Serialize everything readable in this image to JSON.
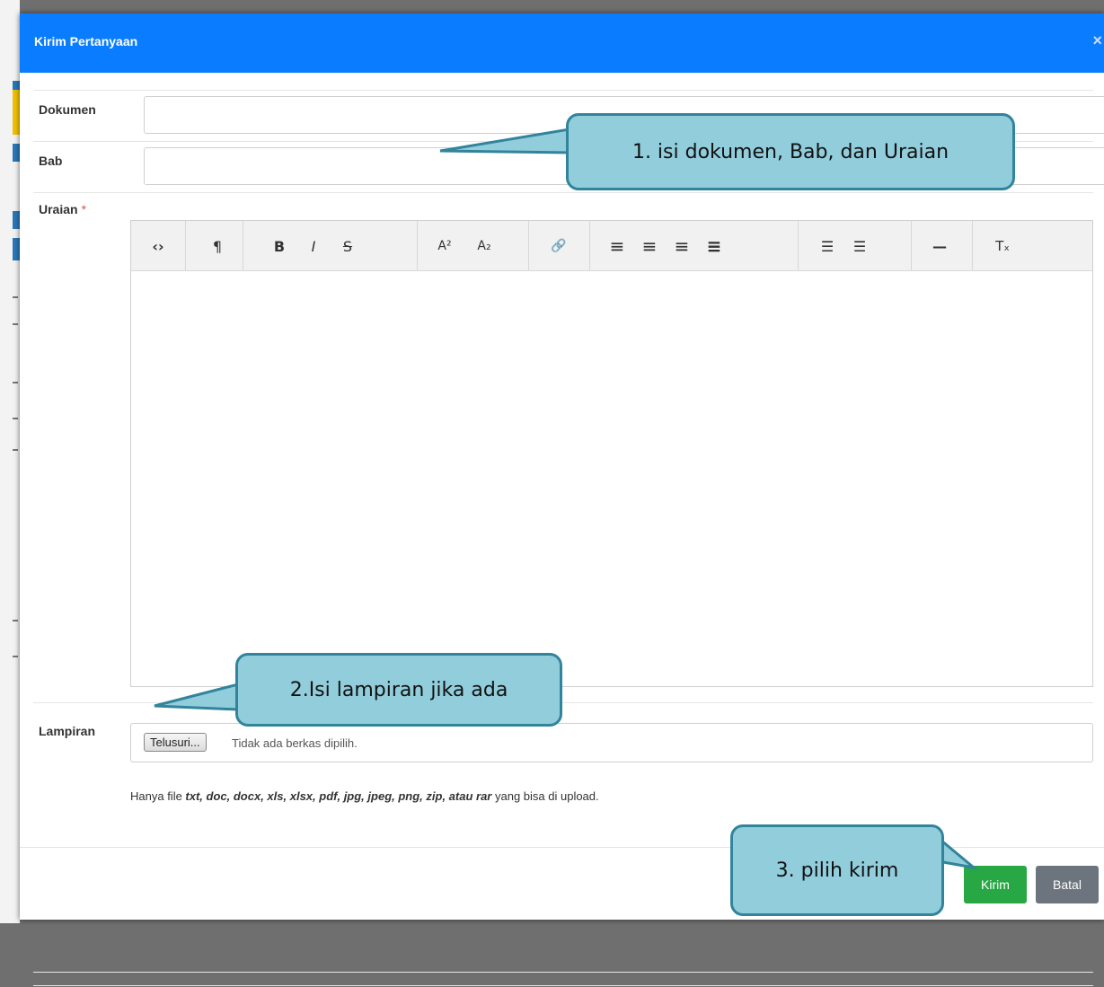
{
  "modal": {
    "title": "Kirim Pertanyaan",
    "close_glyph": "×"
  },
  "form": {
    "dokumen_label": "Dokumen",
    "bab_label": "Bab",
    "uraian_label": "Uraian",
    "required_mark": "*",
    "lampiran_label": "Lampiran",
    "browse_label": "Telusuri...",
    "file_status": "Tidak ada berkas dipilih.",
    "hint_prefix": "Hanya file ",
    "hint_types": "txt, doc, docx, xls, xlsx, pdf, jpg, jpeg, png, zip, atau rar",
    "hint_suffix": " yang bisa di upload."
  },
  "toolbar": {
    "code": "‹›",
    "paragraph": "¶",
    "bold": "B",
    "italic": "I",
    "strike": "S",
    "superscript": "A²",
    "subscript": "A₂",
    "link": "🔗",
    "align_left": "≡",
    "align_center": "≡",
    "align_right": "≡",
    "justify": "≡",
    "ul": "☰",
    "ol": "☰",
    "hr": "—",
    "clear": "Tₓ"
  },
  "buttons": {
    "kirim": "Kirim",
    "batal": "Batal"
  },
  "callouts": {
    "c1": "1. isi dokumen, Bab, dan Uraian",
    "c2": "2.Isi lampiran jika ada",
    "c3": "3. pilih kirim"
  },
  "colors": {
    "header": "#0a7cff",
    "kirim": "#28a745",
    "batal": "#6c757d",
    "callout_fill": "#92cddc",
    "callout_border": "#31849b"
  }
}
